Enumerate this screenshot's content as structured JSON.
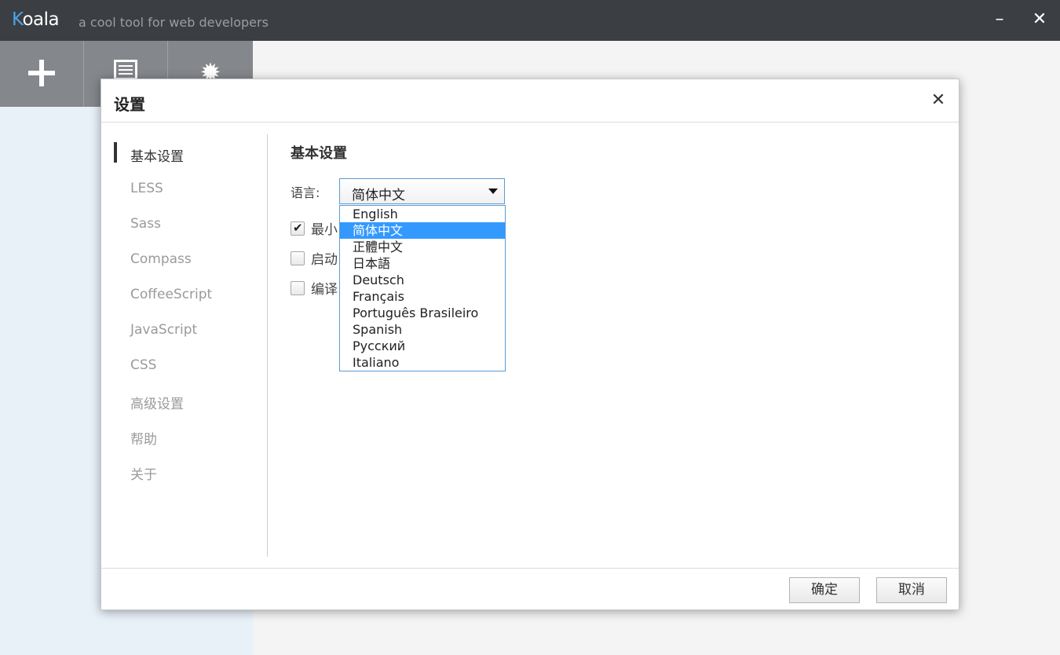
{
  "app": {
    "name_first": "K",
    "name_rest": "oala",
    "subtitle": "a cool tool for web developers",
    "minimize": "–",
    "close": "✕"
  },
  "toolbar": {
    "icons": [
      "plus-icon",
      "list-icon",
      "gear-icon"
    ],
    "gear_glyph": "✹"
  },
  "dialog": {
    "title": "设置",
    "close": "✕",
    "nav": [
      {
        "label": "基本设置",
        "active": true
      },
      {
        "label": "LESS"
      },
      {
        "label": "Sass"
      },
      {
        "label": "Compass"
      },
      {
        "label": "CoffeeScript"
      },
      {
        "label": "JavaScript"
      },
      {
        "label": "CSS"
      },
      {
        "label": "高级设置"
      },
      {
        "label": "帮助"
      },
      {
        "label": "关于"
      }
    ],
    "section_title": "基本设置",
    "language_label": "语言:",
    "language_selected": "简体中文",
    "checkboxes": [
      {
        "label": "最小",
        "checked": true
      },
      {
        "label": "启动",
        "checked": false
      },
      {
        "label": "编译",
        "checked": false
      }
    ],
    "language_options": [
      "English",
      "简体中文",
      "正體中文",
      "日本語",
      "Deutsch",
      "Français",
      "Português Brasileiro",
      "Spanish",
      "Русский",
      "Italiano"
    ],
    "ok_label": "确定",
    "cancel_label": "取消"
  },
  "colors": {
    "titlebar": "#3b3e42",
    "accent": "#4aa5e8",
    "selection": "#3399ff"
  }
}
